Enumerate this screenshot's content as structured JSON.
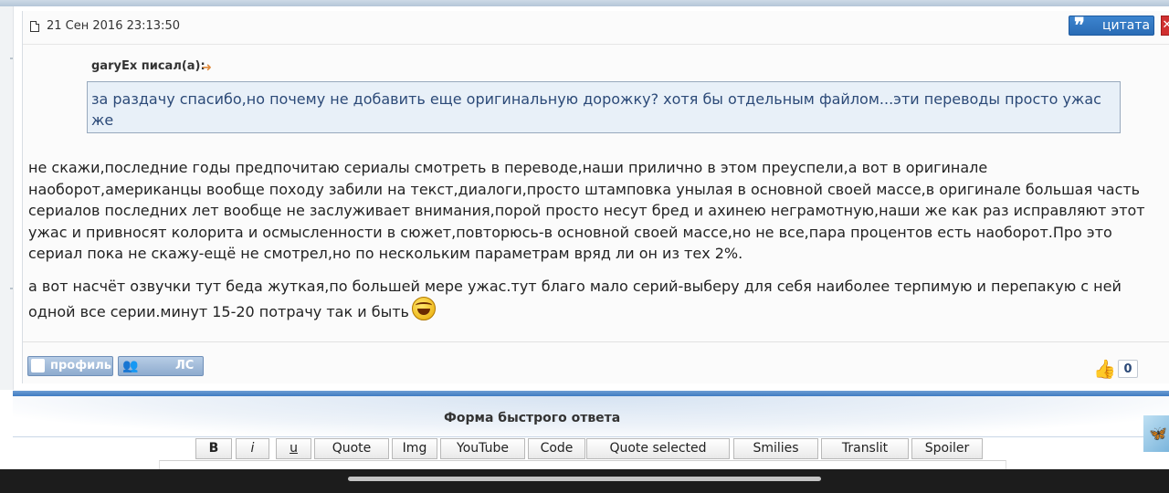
{
  "post": {
    "date": "21 Сен 2016 23:13:50",
    "quote_button": "цитата",
    "quote_mark": "❞",
    "delete_mark": "✕",
    "quoted_author": "garyEx писал(а):",
    "quoted_arrow": "➜",
    "quoted_text": "за раздачу спасибо,но почему не добавить еще оригинальную дорожку? хотя бы отдельным файлом...эти переводы просто ужас же",
    "paragraph1": "не скажи,последние годы предпочитаю сериалы смотреть в переводе,наши прилично в этом преуспели,а вот в оригинале наоборот,американцы вообще походу забили на текст,диалоги,просто штамповка унылая в основной своей массе,в оригинале большая часть сериалов последних лет вообще не заслуживает внимания,порой просто несут бред и ахинею неграмотную,наши же как раз исправляют этот ужас и привносят колорита и осмысленности в сюжет,повторюсь-в основной своей массе,но не все,пара процентов есть наоборот.Про это сериал пока не скажу-ещё не смотрел,но по нескольким параметрам вряд ли он из тех 2%.",
    "paragraph2": "а вот насчёт озвучки тут беда жуткая,по большей мере ужас.тут благо мало серий-выберу для себя наиболее терпимую и перепакую с ней одной все серии.минут 15-20 потрачу так и быть",
    "profile_button": "профиль",
    "pm_button": "ЛС",
    "pm_icon": "👥",
    "like_icon": "👍",
    "like_count": "0",
    "icons": [
      "document-icon",
      "quote-icon",
      "delete-icon",
      "arrow-icon",
      "laughing-smiley-icon",
      "profile-icon",
      "pm-icon",
      "thumbs-up-icon",
      "site-logo-icon"
    ]
  },
  "reply": {
    "title": "Форма быстрого ответа",
    "toolbar": [
      {
        "label": "B",
        "name": "bold-button"
      },
      {
        "label": "i",
        "name": "italic-button"
      },
      {
        "label": "u",
        "name": "underline-button"
      },
      {
        "label": "Quote",
        "name": "quote-tag-button"
      },
      {
        "label": "Img",
        "name": "img-button"
      },
      {
        "label": "YouTube",
        "name": "youtube-button"
      },
      {
        "label": "Code",
        "name": "code-button"
      },
      {
        "label": "Quote selected",
        "name": "quote-selected-button"
      },
      {
        "label": "Smilies",
        "name": "smilies-button"
      },
      {
        "label": "Translit",
        "name": "translit-button"
      },
      {
        "label": "Spoiler",
        "name": "spoiler-button"
      }
    ],
    "logo_glyph": "🦋"
  }
}
